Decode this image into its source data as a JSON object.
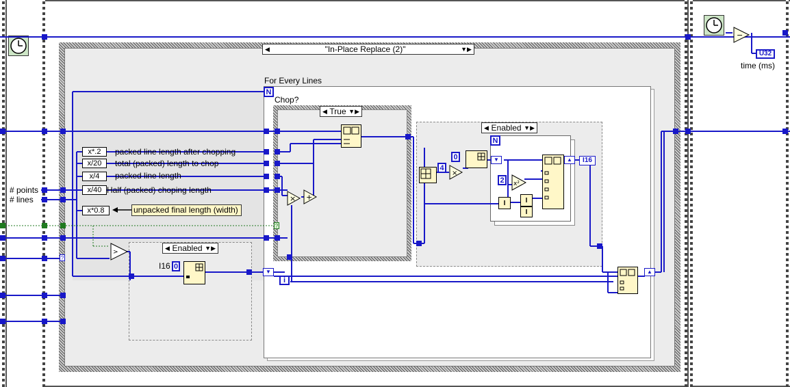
{
  "case_selector": "\"In-Place Replace (2)\"",
  "for_loop_label": "For Every Lines",
  "chop_label": "Chop?",
  "true_case": "True",
  "enabled_left": "Enabled",
  "enabled_right": "Enabled",
  "loop_count_terminal": "N",
  "inner_loop_count_terminal": "N",
  "iteration_terminal": "i",
  "time_label": "time (ms)",
  "u32_indicator": "U32",
  "i16_label": "I16",
  "i16_indicator": "I16",
  "controls": {
    "points": "# points",
    "lines": "# lines"
  },
  "expressions": [
    {
      "node": "x*.2",
      "label": "packed line length after chopping"
    },
    {
      "node": "x/20",
      "label": "total (packed) length to chop"
    },
    {
      "node": "x/4",
      "label": "packed line length"
    },
    {
      "node": "x/40",
      "label": "Half (packed) choping length"
    },
    {
      "node": "x*0.8",
      "label": "unpacked final length (width)"
    }
  ],
  "constants": {
    "zero_left": "0",
    "four": "4",
    "zero_right": "0",
    "two": "2"
  },
  "operators": {
    "multiply": "×",
    "add": "+",
    "square": "x²"
  },
  "colors": {
    "wire_blue": "#1818c8",
    "wire_green": "#1f7a1f",
    "case_background": "#ececec",
    "tip_yellow": "#fff7c8"
  }
}
